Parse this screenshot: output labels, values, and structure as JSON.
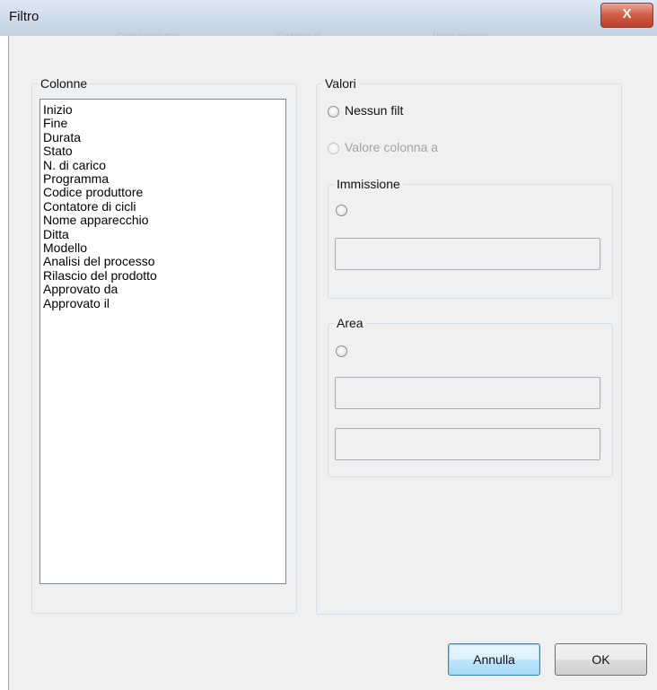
{
  "window": {
    "title": "Filtro",
    "close_glyph": "X",
    "background_tabs": [
      "Codice produttore",
      "Contatore di ...",
      "Nome apparecc..."
    ]
  },
  "columns_group": {
    "legend": "Colonne",
    "items": [
      "Inizio",
      "Fine",
      "Durata",
      "Stato",
      "N. di carico",
      "Programma",
      "Codice produttore",
      "Contatore di cicli",
      "Nome apparecchio",
      "Ditta",
      "Modello",
      "Analisi del processo",
      "Rilascio del prodotto",
      "Approvato da",
      "Approvato il"
    ]
  },
  "values_group": {
    "legend": "Valori",
    "no_filter_label": "Nessun filt",
    "column_value_label": "Valore colonna a",
    "entry_group": {
      "legend": "Immissione",
      "radio_label": "",
      "input_value": ""
    },
    "range_group": {
      "legend": "Area",
      "radio_label": "",
      "from_value": "",
      "to_value": ""
    }
  },
  "buttons": {
    "cancel": "Annulla",
    "ok": "OK"
  },
  "colors": {
    "dialog_bg": "#f0f0f0",
    "group_border": "#d5dfe5",
    "close_button": "#c0412a",
    "default_button_border": "#3c7fb1",
    "disabled_text": "#a4a4a4"
  }
}
